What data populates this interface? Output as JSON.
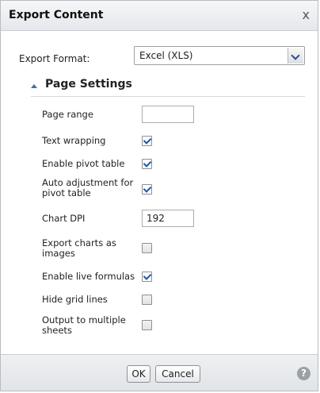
{
  "dialog": {
    "title": "Export Content",
    "close_glyph": "x"
  },
  "format": {
    "label": "Export Format:",
    "selected": "Excel (XLS)"
  },
  "section": {
    "title": "Page Settings",
    "collapse_icon": "caret-up-icon"
  },
  "settings": {
    "page_range": {
      "label": "Page range",
      "value": ""
    },
    "text_wrapping": {
      "label": "Text wrapping",
      "checked": true
    },
    "enable_pivot": {
      "label": "Enable pivot table",
      "checked": true
    },
    "auto_adjust": {
      "label": "Auto adjustment for pivot table",
      "checked": true
    },
    "chart_dpi": {
      "label": "Chart DPI",
      "value": "192"
    },
    "export_charts": {
      "label": "Export charts as images",
      "checked": false
    },
    "live_formulas": {
      "label": "Enable live formulas",
      "checked": true
    },
    "hide_grid": {
      "label": "Hide grid lines",
      "checked": false
    },
    "multiple_sheets": {
      "label": "Output to multiple sheets",
      "checked": false
    }
  },
  "footer": {
    "ok_label": "OK",
    "cancel_label": "Cancel",
    "help_glyph": "?"
  },
  "colors": {
    "accent": "#1f55a3",
    "title_bg": "#e5e7ea"
  }
}
